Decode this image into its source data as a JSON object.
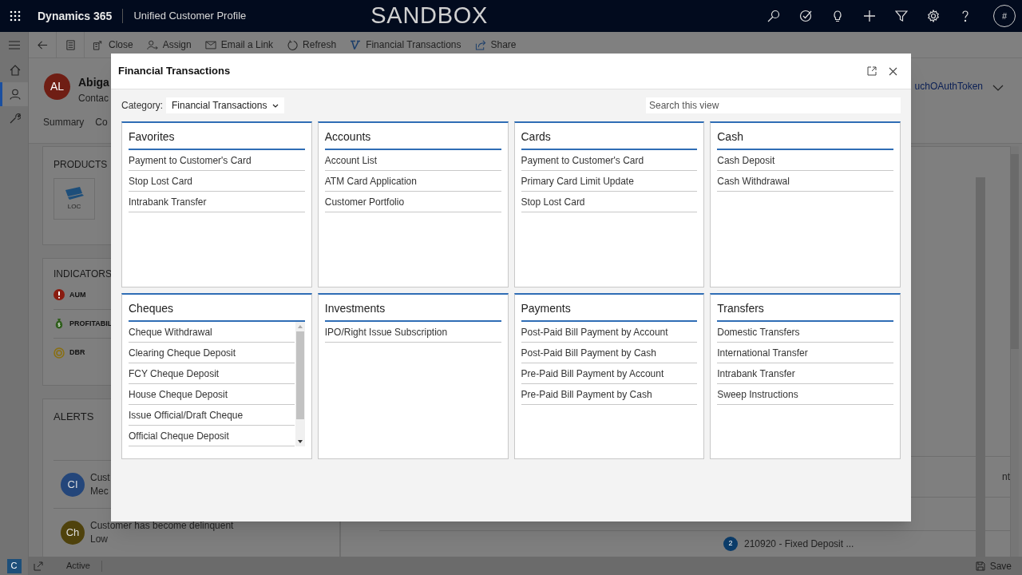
{
  "app_header": {
    "app_name": "Dynamics 365",
    "area": "Unified Customer Profile",
    "environment": "SANDBOX",
    "tools": [
      {
        "kind": "search"
      },
      {
        "kind": "task"
      },
      {
        "kind": "idea"
      },
      {
        "kind": "add"
      },
      {
        "kind": "filter"
      },
      {
        "kind": "settings"
      },
      {
        "kind": "help"
      }
    ],
    "user_initial": "#"
  },
  "left_nav": [
    {
      "kind": "home",
      "selected": false
    },
    {
      "kind": "contacts",
      "selected": true
    },
    {
      "kind": "tools",
      "selected": false
    }
  ],
  "command_bar": [
    {
      "kind": "back"
    },
    {
      "kind": "form"
    },
    {
      "kind": "close",
      "label": "Close"
    },
    {
      "kind": "assign",
      "label": "Assign"
    },
    {
      "kind": "email",
      "label": "Email a Link"
    },
    {
      "kind": "refresh",
      "label": "Refresh"
    },
    {
      "kind": "transactions",
      "label": "Financial Transactions"
    },
    {
      "kind": "share",
      "label": "Share"
    }
  ],
  "record": {
    "initials": "AL",
    "name": "Abiga",
    "type": "Contac",
    "tabs": [
      "Summary",
      "Co"
    ],
    "link": "uchOAuthToken"
  },
  "products": {
    "title": "PRODUCTS",
    "items": [
      "LOC"
    ]
  },
  "indicators": {
    "title": "INDICATORS",
    "items": [
      {
        "kind": "alert",
        "label": "AUM"
      },
      {
        "kind": "money",
        "label": "PROFITABIL"
      },
      {
        "kind": "target",
        "label": "DBR"
      }
    ]
  },
  "alerts": {
    "title": "ALERTS",
    "items": [
      {
        "initials": "CI",
        "color": "#24467a",
        "title": "Cust",
        "level": "Mec"
      },
      {
        "initials": "Ch",
        "color": "#4f420c",
        "title": "Customer has become delinquent",
        "level": "Low"
      }
    ]
  },
  "side_list": {
    "fragment": "nt",
    "item": {
      "badge": "2",
      "text": "210920 - Fixed Deposit ..."
    }
  },
  "status_bar": {
    "user_initial": "C",
    "status": "Active",
    "save": "Save"
  },
  "dialog": {
    "title": "Financial Transactions",
    "category_label": "Category:",
    "category_value": "Financial Transactions",
    "search_placeholder": "Search this view",
    "groups": [
      {
        "title": "Favorites",
        "scrollbar": false,
        "items": [
          "Payment to Customer's Card",
          "Stop Lost Card",
          "Intrabank Transfer"
        ]
      },
      {
        "title": "Accounts",
        "scrollbar": false,
        "items": [
          "Account List",
          "ATM Card Application",
          "Customer Portfolio"
        ]
      },
      {
        "title": "Cards",
        "scrollbar": false,
        "items": [
          "Payment to Customer's Card",
          "Primary Card Limit Update",
          "Stop Lost Card"
        ]
      },
      {
        "title": "Cash",
        "scrollbar": false,
        "items": [
          "Cash Deposit",
          "Cash Withdrawal"
        ]
      },
      {
        "title": "Cheques",
        "scrollbar": true,
        "items": [
          "Cheque Withdrawal",
          "Clearing Cheque Deposit",
          "FCY Cheque Deposit",
          "House Cheque Deposit",
          "Issue Official/Draft Cheque",
          "Official Cheque Deposit"
        ]
      },
      {
        "title": "Investments",
        "scrollbar": false,
        "items": [
          "IPO/Right Issue Subscription"
        ]
      },
      {
        "title": "Payments",
        "scrollbar": false,
        "items": [
          "Post-Paid Bill Payment by Account",
          "Post-Paid Bill Payment by Cash",
          "Pre-Paid Bill Payment by Account",
          "Pre-Paid Bill Payment by Cash"
        ]
      },
      {
        "title": "Transfers",
        "scrollbar": false,
        "items": [
          "Domestic Transfers",
          "International Transfer",
          "Intrabank Transfer",
          "Sweep Instructions"
        ]
      }
    ]
  }
}
